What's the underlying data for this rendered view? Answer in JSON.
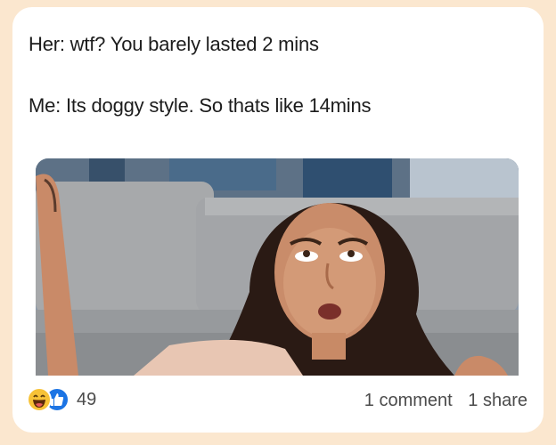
{
  "post": {
    "line1": "Her: wtf? You barely lasted 2 mins",
    "line2": "Me: Its doggy style. So thats like 14mins"
  },
  "reactions": {
    "icons": [
      "haha-icon",
      "like-icon"
    ],
    "count": "49"
  },
  "stats": {
    "comments": "1 comment",
    "shares": "1 share"
  },
  "colors": {
    "page_background": "#fbe7cf",
    "card_background": "#ffffff",
    "like_blue": "#1b74e4",
    "haha_yellow": "#f7c236"
  }
}
